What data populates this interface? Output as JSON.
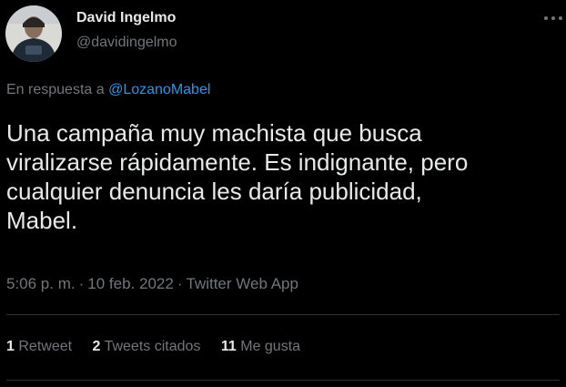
{
  "author": {
    "display_name": "David Ingelmo",
    "handle": "@davidingelmo"
  },
  "reply": {
    "prefix": "En respuesta a ",
    "mention": "@LozanoMabel"
  },
  "tweet": {
    "text": "Una campaña muy machista que busca\nviralizarse rápidamente. Es indignante, pero\ncualquier denuncia les daría publicidad,\nMabel."
  },
  "meta": {
    "time": "5:06 p. m.",
    "date": "10 feb. 2022",
    "source": "Twitter Web App",
    "separator": "·"
  },
  "stats": {
    "retweets": {
      "count": "1",
      "label": "Retweet"
    },
    "quotes": {
      "count": "2",
      "label": "Tweets citados"
    },
    "likes": {
      "count": "11",
      "label": "Me gusta"
    }
  },
  "colors": {
    "background": "#000000",
    "text": "#e7e9ea",
    "secondary": "#71767b",
    "link": "#1d9bf0",
    "divider": "#2f3336"
  }
}
